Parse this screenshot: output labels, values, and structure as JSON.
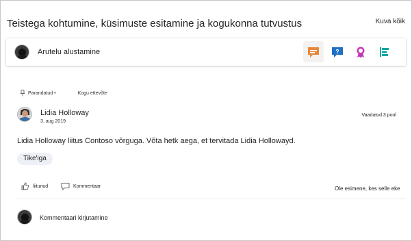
{
  "header": {
    "title": "Teistega kohtumine, küsimuste esitamine ja kogukonna tutvustus",
    "see_all": "Kuva kõik"
  },
  "composer": {
    "label": "Arutelu alustamine",
    "types": [
      {
        "name": "discussion",
        "icon": "chat-bubble-icon",
        "color": "#e8873a"
      },
      {
        "name": "question",
        "icon": "question-bubble-icon",
        "color": "#1f6fc5"
      },
      {
        "name": "praise",
        "icon": "ribbon-icon",
        "color": "#c239b3"
      },
      {
        "name": "poll",
        "icon": "poll-icon",
        "color": "#00a5a0"
      }
    ]
  },
  "post": {
    "status": "Parandatud •",
    "scope": "Kogu ettevõte",
    "author": "Lidia Holloway",
    "date": "3. aug 2019",
    "views": "Vaadatud 3 pool",
    "text": "Lidia Holloway liitus Contoso võrguga. Võta hetk aega, et tervitada Lidia Hollowayd.",
    "tag": "Tike'iga",
    "like_label": "liitunud",
    "comment_label": "Kommentaar",
    "be_first": "Ole esimene, kes selle eke",
    "reply_placeholder": "Kommentaari kirjutamine"
  }
}
